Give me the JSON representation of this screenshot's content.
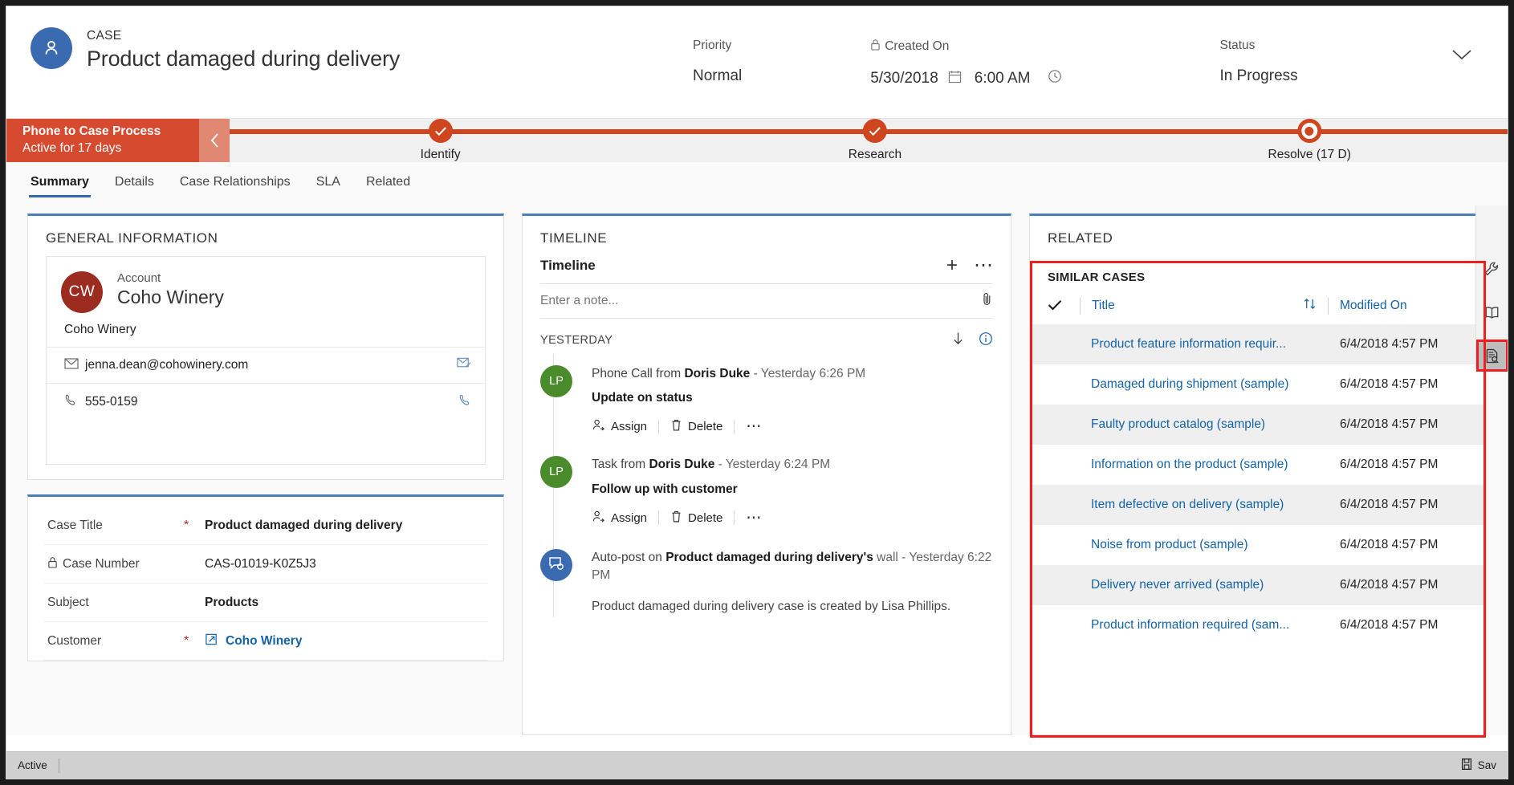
{
  "header": {
    "kicker": "CASE",
    "title": "Product damaged during delivery",
    "avatar_icon": "contact-icon",
    "expand_icon": "chevron-down-icon",
    "fields": [
      {
        "label": "Priority",
        "value": "Normal",
        "lock": false
      },
      {
        "label": "Created On",
        "value": "5/30/2018",
        "value2": "6:00 AM",
        "lock": true
      },
      {
        "label": "Status",
        "value": "In Progress",
        "lock": false
      }
    ]
  },
  "process": {
    "name": "Phone to Case Process",
    "subtitle": "Active for 17 days",
    "collapse_icon": "chevron-left-icon",
    "stages": [
      {
        "label": "Identify",
        "state": "complete"
      },
      {
        "label": "Research",
        "state": "complete"
      },
      {
        "label": "Resolve  (17 D)",
        "state": "active"
      }
    ]
  },
  "tabs": [
    {
      "label": "Summary",
      "active": true
    },
    {
      "label": "Details",
      "active": false
    },
    {
      "label": "Case Relationships",
      "active": false
    },
    {
      "label": "SLA",
      "active": false
    },
    {
      "label": "Related",
      "active": false
    }
  ],
  "general_information": {
    "card_title": "GENERAL INFORMATION",
    "account": {
      "initials": "CW",
      "label": "Account",
      "name": "Coho Winery",
      "sub": "Coho Winery",
      "email": "jenna.dean@cohowinery.com",
      "phone": "555-0159"
    },
    "fields": [
      {
        "label": "Case Title",
        "value": "Product damaged during delivery",
        "required": true,
        "locked": false,
        "link": false
      },
      {
        "label": "Case Number",
        "value": "CAS-01019-K0Z5J3",
        "required": false,
        "locked": true,
        "link": false
      },
      {
        "label": "Subject",
        "value": "Products",
        "required": false,
        "locked": false,
        "link": false
      },
      {
        "label": "Customer",
        "value": "Coho Winery",
        "required": true,
        "locked": false,
        "link": true
      }
    ]
  },
  "timeline": {
    "card_title": "TIMELINE",
    "header_label": "Timeline",
    "add_label": "+",
    "more_label": "⋯",
    "note_placeholder": "Enter a note...",
    "attach_icon": "paperclip-icon",
    "day_group": "YESTERDAY",
    "sort_icon": "arrow-down-icon",
    "info_icon": "info-icon",
    "items": [
      {
        "initials": "LP",
        "avatar_color": "#4a8b2c",
        "badge_icon": "phone-outgoing-icon",
        "prefix": "Phone Call from ",
        "actor": "Doris Duke",
        "datetime": "-  Yesterday 6:26 PM",
        "subject": "Update on status",
        "actions": [
          {
            "label": "Assign",
            "icon": "assign-user-icon"
          },
          {
            "label": "Delete",
            "icon": "trash-icon"
          }
        ],
        "more": "⋯"
      },
      {
        "initials": "LP",
        "avatar_color": "#4a8b2c",
        "badge_icon": "task-checkbox-icon",
        "prefix": "Task from ",
        "actor": "Doris Duke",
        "datetime": "-  Yesterday 6:24 PM",
        "subject": "Follow up with customer",
        "actions": [
          {
            "label": "Assign",
            "icon": "assign-user-icon"
          },
          {
            "label": "Delete",
            "icon": "trash-icon"
          }
        ],
        "more": "⋯"
      },
      {
        "initials": "",
        "avatar_color": "#3a6ab0",
        "badge_icon": "auto-post-icon",
        "prefix": "Auto-post on ",
        "actor": "Product damaged during delivery's",
        "datetime": " wall -  Yesterday 6:22 PM",
        "subject": "",
        "clipped": "Product damaged during delivery case is created by Lisa Phillips.",
        "actions": [],
        "more": ""
      }
    ]
  },
  "related": {
    "card_title": "RELATED",
    "similar_cases_title": "SIMILAR CASES",
    "columns": {
      "check_icon": "checkmark-icon",
      "title": "Title",
      "sort_icon": "sort-updown-icon",
      "modified_on": "Modified On"
    },
    "rows": [
      {
        "title": "Product feature information requir...",
        "modified": "6/4/2018 4:57 PM"
      },
      {
        "title": "Damaged during shipment (sample)",
        "modified": "6/4/2018 4:57 PM"
      },
      {
        "title": "Faulty product catalog (sample)",
        "modified": "6/4/2018 4:57 PM"
      },
      {
        "title": "Information on the product (sample)",
        "modified": "6/4/2018 4:57 PM"
      },
      {
        "title": "Item defective on delivery (sample)",
        "modified": "6/4/2018 4:57 PM"
      },
      {
        "title": "Noise from product (sample)",
        "modified": "6/4/2018 4:57 PM"
      },
      {
        "title": "Delivery never arrived (sample)",
        "modified": "6/4/2018 4:57 PM"
      },
      {
        "title": "Product information required (sam...",
        "modified": "6/4/2018 4:57 PM"
      }
    ]
  },
  "rail": [
    {
      "icon": "wrench-icon",
      "selected": false
    },
    {
      "icon": "knowledge-book-icon",
      "selected": false
    },
    {
      "icon": "similar-records-icon",
      "selected": true
    }
  ],
  "statusbar": {
    "state": "Active",
    "save_label": "Sav",
    "save_icon": "save-icon"
  },
  "colors": {
    "process_red": "#cf4520",
    "accent_blue": "#2f6cb5",
    "link_blue": "#1463a8",
    "highlight_red": "#f01e1e",
    "account_avatar": "#9c2b20",
    "timeline_green": "#4a8b2c"
  }
}
